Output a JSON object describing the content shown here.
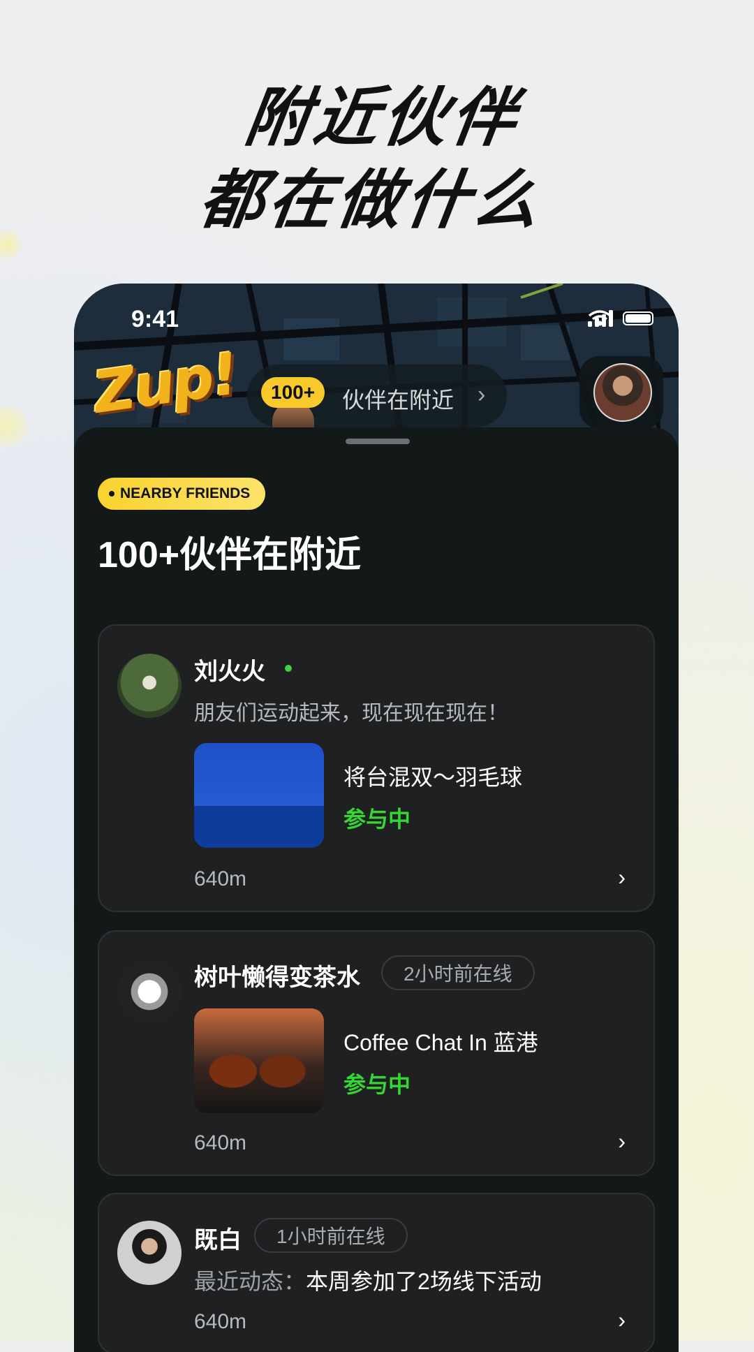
{
  "headline": {
    "line1": "附近伙伴",
    "line2": "都在做什么"
  },
  "status_bar": {
    "time": "9:41"
  },
  "map_header": {
    "logo_text": "Zup!",
    "pill_count": "100+",
    "pill_text": "伙伴在附近",
    "pill_chevron": "›"
  },
  "sheet": {
    "badge": "NEARBY FRIENDS",
    "title": "100+伙伴在附近"
  },
  "cards": [
    {
      "name": "刘火火",
      "online": true,
      "desc": "朋友们运动起来，现在现在现在！",
      "event_title": "将台混双～羽毛球",
      "event_status": "参与中",
      "distance": "640m",
      "chevron": "›"
    },
    {
      "name": "树叶懒得变茶水",
      "status": "2小时前在线",
      "event_title": "Coffee Chat In 蓝港",
      "event_status": "参与中",
      "distance": "640m",
      "chevron": "›"
    },
    {
      "name": "既白",
      "status": "1小时前在线",
      "recent_label": "最近动态：",
      "recent_value": "本周参加了2场线下活动",
      "distance": "640m",
      "chevron": "›"
    }
  ],
  "colors": {
    "accent_yellow": "#f9d22e",
    "online_green": "#3bd43b",
    "status_green": "#36d632",
    "sheet_bg": "#131818",
    "card_bg": "#1e2022"
  },
  "icons": [
    "signal-icon",
    "wifi-icon",
    "battery-icon",
    "chevron-right-icon"
  ]
}
